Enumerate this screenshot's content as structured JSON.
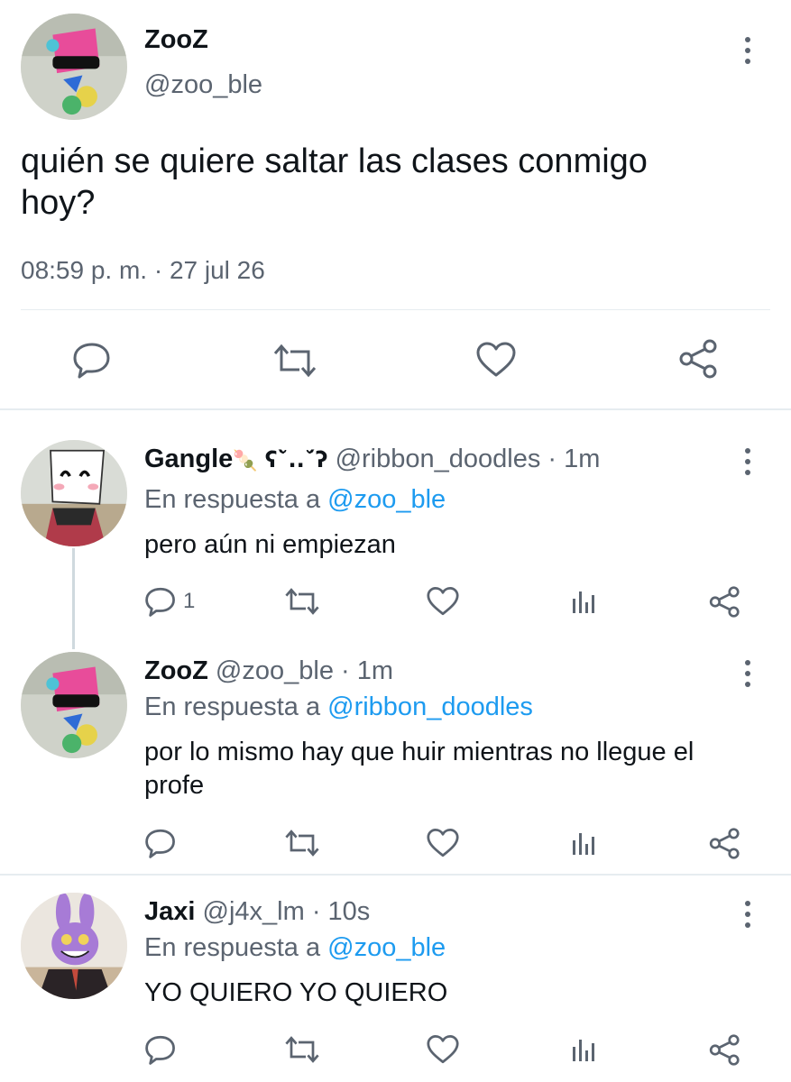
{
  "main_tweet": {
    "display_name": "ZooZ",
    "handle": "@zoo_ble",
    "text_line1": "quién se quiere saltar las clases conmigo",
    "text_line2": "hoy?",
    "timestamp": "08:59 p. m. · 27 jul 26"
  },
  "replies": [
    {
      "display_name": "Gangle",
      "name_emoji": "🍡",
      "name_suffix": "ʕ˘̀..˘́ʔ",
      "handle": "@ribbon_doodles",
      "time": "· 1m",
      "reply_prefix": "En respuesta a",
      "reply_to": "@zoo_ble",
      "text": "pero aún ni empiezan",
      "reply_count": "1"
    },
    {
      "display_name": "ZooZ",
      "handle": "@zoo_ble",
      "time": "· 1m",
      "reply_prefix": "En respuesta a",
      "reply_to": "@ribbon_doodles",
      "text_line1": "por lo mismo hay que huir mientras no llegue el",
      "text_line2": "profe"
    },
    {
      "display_name": "Jaxi",
      "handle": "@j4x_lm",
      "time": "· 10s",
      "reply_prefix": "En respuesta a",
      "reply_to": "@zoo_ble",
      "text": "YO QUIERO YO QUIERO"
    }
  ],
  "icons": [
    "reply-icon",
    "retweet-icon",
    "like-icon",
    "share-icon",
    "analytics-icon",
    "more-icon"
  ],
  "colors": {
    "link": "#1d9bf0",
    "muted": "#5b6470",
    "icon": "#5b6470",
    "divider": "#e6ecf0"
  }
}
